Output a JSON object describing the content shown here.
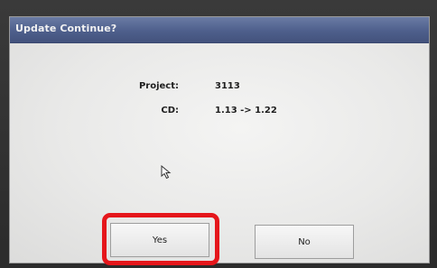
{
  "dialog": {
    "title": "Update Continue?",
    "fields": [
      {
        "label": "Project:",
        "value": "3113"
      },
      {
        "label": "CD:",
        "value": "1.13 -> 1.22"
      }
    ],
    "buttons": {
      "yes_label": "Yes",
      "no_label": "No"
    }
  },
  "colors": {
    "titlebar": "#4e5f8c",
    "highlight": "#e5161b"
  }
}
